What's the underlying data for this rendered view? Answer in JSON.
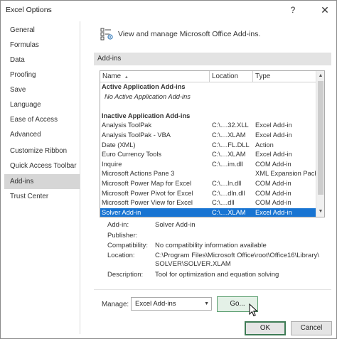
{
  "window": {
    "title": "Excel Options",
    "help_glyph": "?",
    "close_glyph": "✕"
  },
  "sidebar": {
    "items": [
      {
        "label": "General"
      },
      {
        "label": "Formulas"
      },
      {
        "label": "Data"
      },
      {
        "label": "Proofing"
      },
      {
        "label": "Save"
      },
      {
        "label": "Language"
      },
      {
        "label": "Ease of Access"
      },
      {
        "label": "Advanced"
      },
      {
        "label": "Customize Ribbon"
      },
      {
        "label": "Quick Access Toolbar"
      },
      {
        "label": "Add-ins"
      },
      {
        "label": "Trust Center"
      }
    ],
    "active": "Add-ins"
  },
  "main": {
    "header": "View and manage Microsoft Office Add-ins.",
    "section_title": "Add-ins",
    "columns": {
      "name": "Name",
      "sort_glyph": "▲",
      "location": "Location",
      "type": "Type"
    },
    "rows": [
      {
        "kind": "group",
        "name": "Active Application Add-ins",
        "location": "",
        "type": ""
      },
      {
        "kind": "empty",
        "name": "No Active Application Add-ins",
        "location": "",
        "type": ""
      },
      {
        "kind": "spacer",
        "name": "",
        "location": "",
        "type": ""
      },
      {
        "kind": "group",
        "name": "Inactive Application Add-ins",
        "location": "",
        "type": ""
      },
      {
        "kind": "item",
        "name": "Analysis ToolPak",
        "location": "C:\\....32.XLL",
        "type": "Excel Add-in"
      },
      {
        "kind": "item",
        "name": "Analysis ToolPak - VBA",
        "location": "C:\\....XLAM",
        "type": "Excel Add-in"
      },
      {
        "kind": "item",
        "name": "Date (XML)",
        "location": "C:\\....FL.DLL",
        "type": "Action"
      },
      {
        "kind": "item",
        "name": "Euro Currency Tools",
        "location": "C:\\....XLAM",
        "type": "Excel Add-in"
      },
      {
        "kind": "item",
        "name": "Inquire",
        "location": "C:\\....im.dll",
        "type": "COM Add-in"
      },
      {
        "kind": "item",
        "name": "Microsoft Actions Pane 3",
        "location": "",
        "type": "XML Expansion Pack"
      },
      {
        "kind": "item",
        "name": "Microsoft Power Map for Excel",
        "location": "C:\\....ln.dll",
        "type": "COM Add-in"
      },
      {
        "kind": "item",
        "name": "Microsoft Power Pivot for Excel",
        "location": "C:\\....dln.dll",
        "type": "COM Add-in"
      },
      {
        "kind": "item",
        "name": "Microsoft Power View for Excel",
        "location": "C:\\....dll",
        "type": "COM Add-in"
      },
      {
        "kind": "selected",
        "name": "Solver Add-in",
        "location": "C:\\....XLAM",
        "type": "Excel Add-in"
      }
    ],
    "details": {
      "addin_label": "Add-in:",
      "addin_value": "Solver Add-in",
      "publisher_label": "Publisher:",
      "publisher_value": "",
      "compat_label": "Compatibility:",
      "compat_value": "No compatibility information available",
      "location_label": "Location:",
      "location_value_1": "C:\\Program Files\\Microsoft Office\\root\\Office16\\Library\\",
      "location_value_2": "SOLVER\\SOLVER.XLAM",
      "description_label": "Description:",
      "description_value": "Tool for optimization and equation solving"
    },
    "manage": {
      "label": "Manage:",
      "value": "Excel Add-ins",
      "go_label": "Go..."
    }
  },
  "footer": {
    "ok_label": "OK",
    "cancel_label": "Cancel"
  },
  "colors": {
    "selection": "#1874d2",
    "active_nav": "#d6d6d6",
    "section_bar": "#e3e3e3",
    "go_border": "#5a9e6f"
  }
}
